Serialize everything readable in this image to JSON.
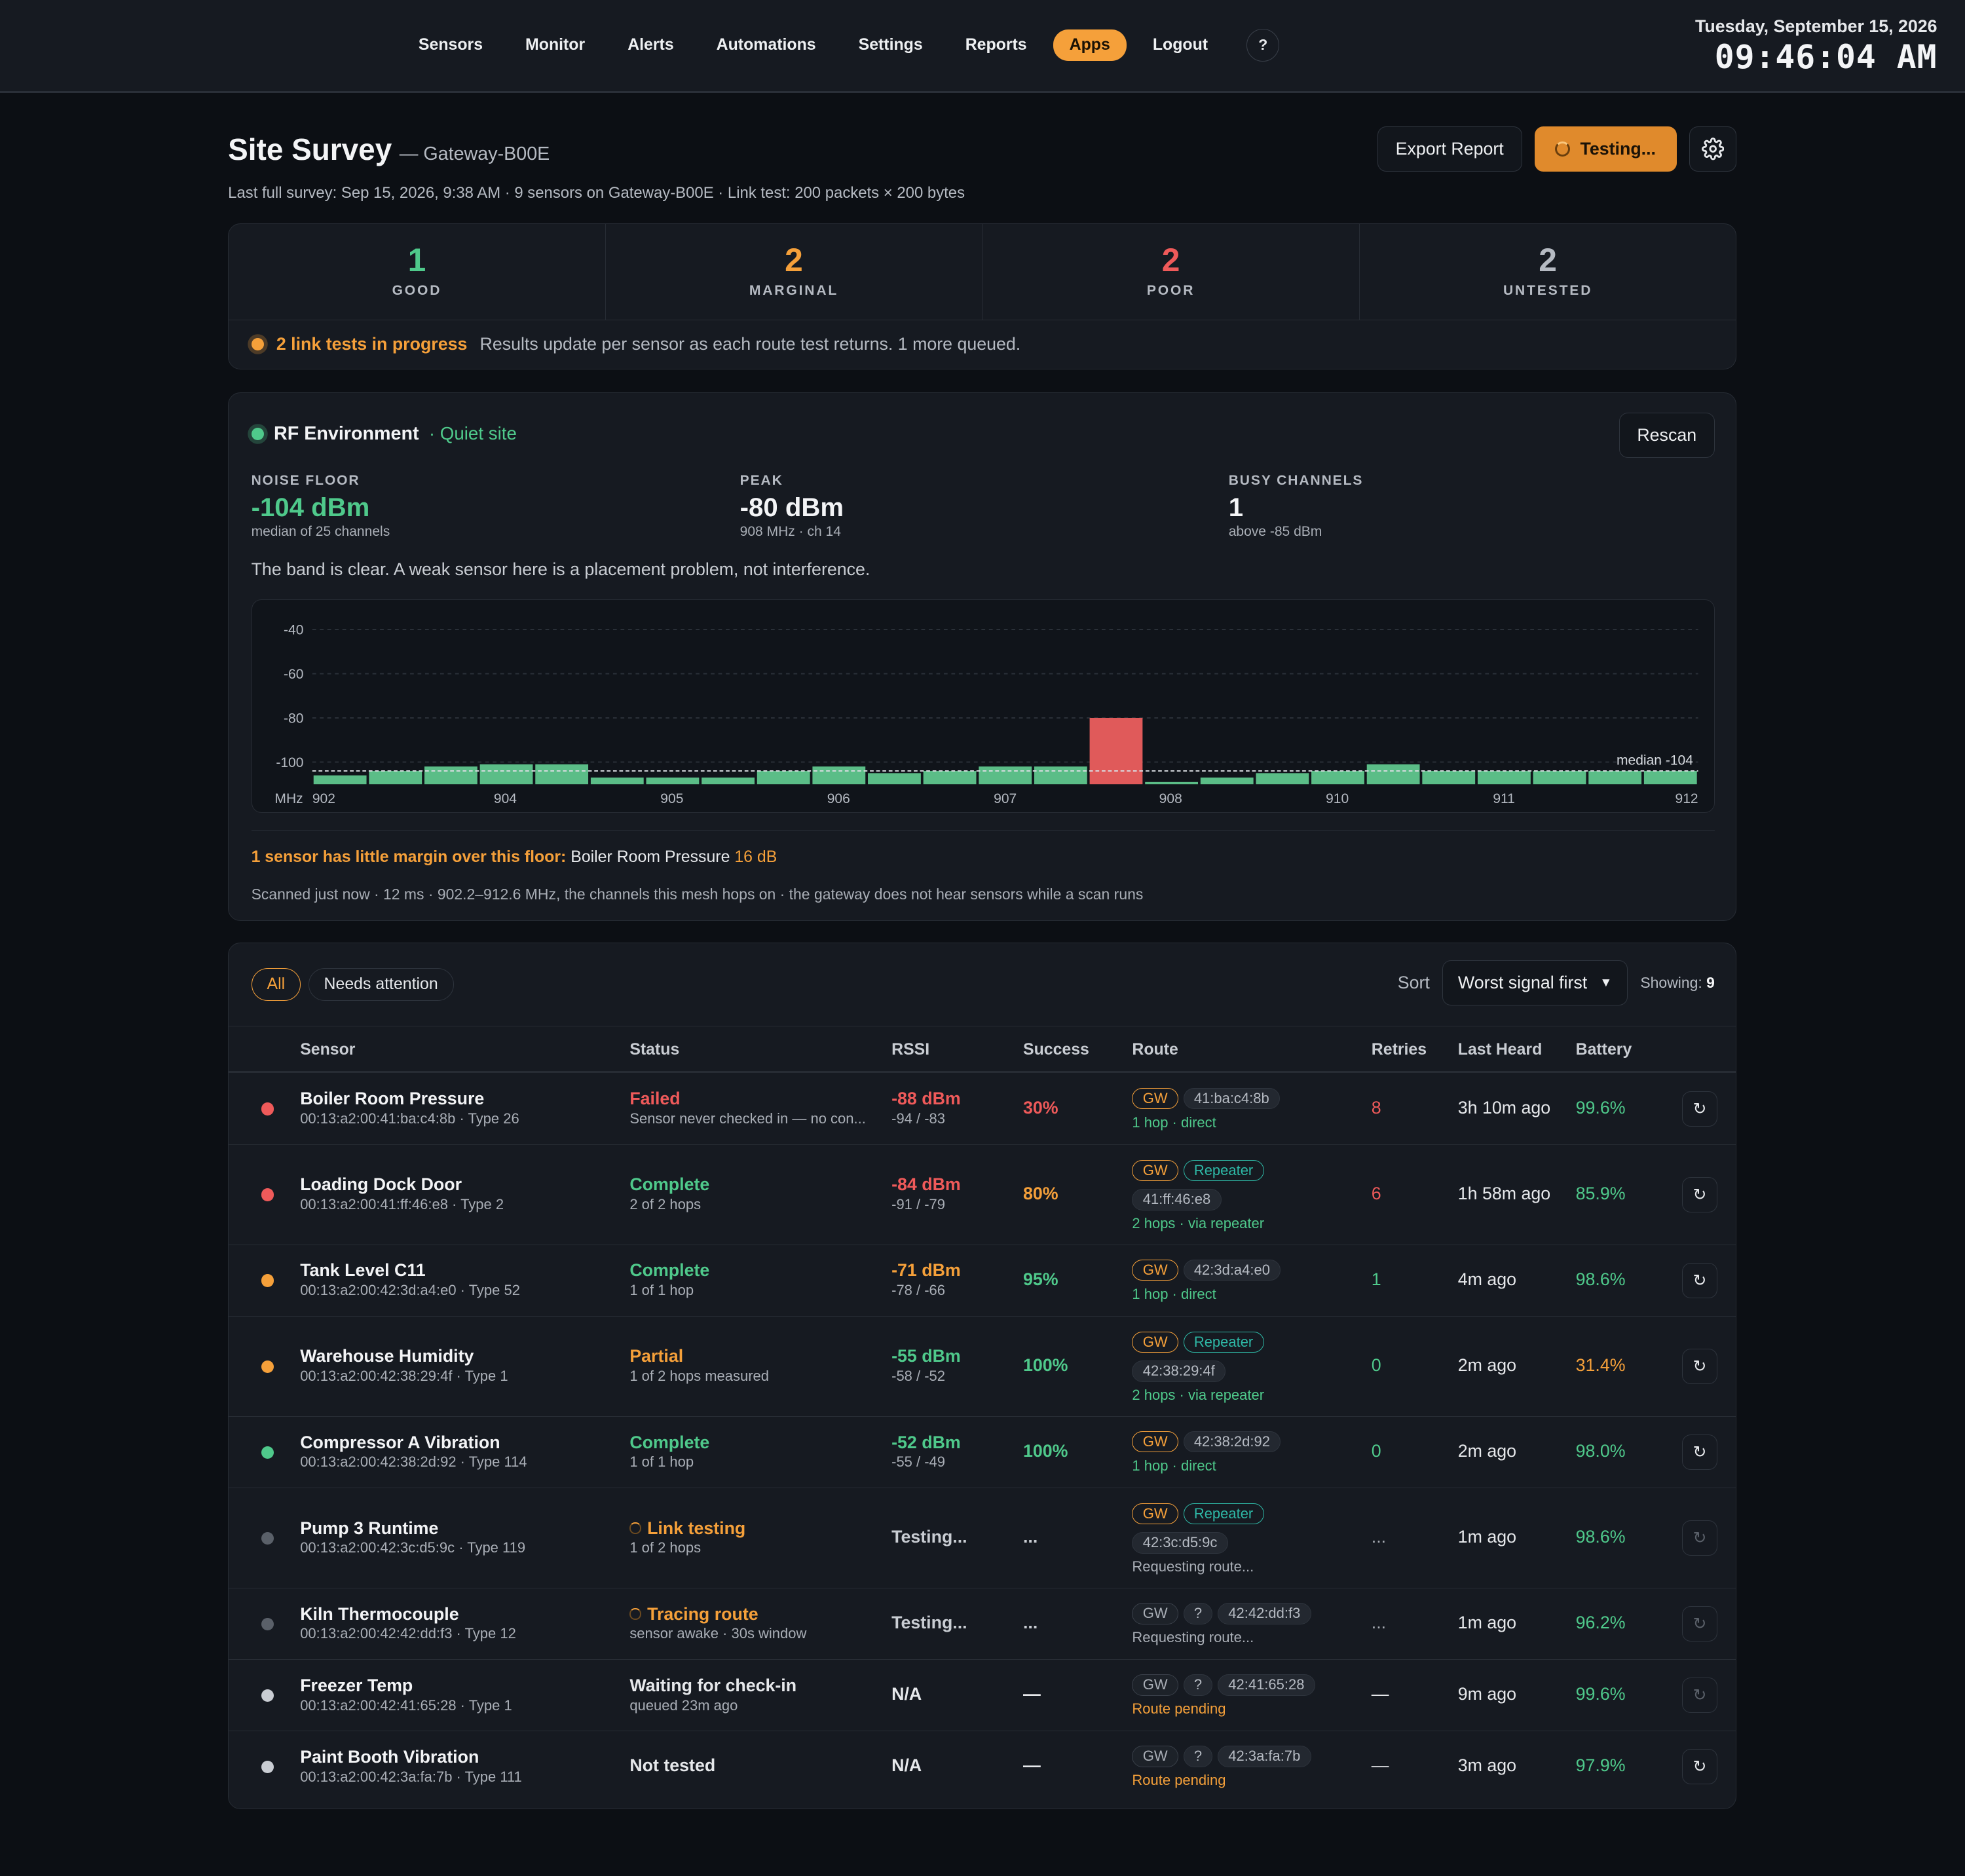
{
  "nav": {
    "items": [
      "Sensors",
      "Monitor",
      "Alerts",
      "Automations",
      "Settings",
      "Reports",
      "Apps",
      "Logout"
    ],
    "active": "Apps",
    "help": "?"
  },
  "clock": {
    "date": "Tuesday, September 15, 2026",
    "time": "09:46:04 AM"
  },
  "header": {
    "title": "Site Survey",
    "gateway": "— Gateway-B00E",
    "subtitle": "Last full survey: Sep 15, 2026, 9:38 AM · 9 sensors on Gateway-B00E · Link test: 200 packets × 200 bytes",
    "export_label": "Export Report",
    "testing_label": "Testing..."
  },
  "counts": [
    {
      "value": "1",
      "label": "GOOD",
      "color": "#4fc98b"
    },
    {
      "value": "2",
      "label": "MARGINAL",
      "color": "#f5a03a"
    },
    {
      "value": "2",
      "label": "POOR",
      "color": "#ef5a5a"
    },
    {
      "value": "2",
      "label": "UNTESTED",
      "color": "#b5bac2"
    }
  ],
  "in_progress": {
    "highlight": "2 link tests in progress",
    "text": "Results update per sensor as each route test returns. 1 more queued."
  },
  "rf": {
    "title": "RF Environment",
    "status": "· Quiet site",
    "rescan_label": "Rescan",
    "metrics": [
      {
        "key": "NOISE FLOOR",
        "value": "-104 dBm",
        "sub": "median of 25 channels",
        "color": "#4fc98b"
      },
      {
        "key": "PEAK",
        "value": "-80 dBm",
        "sub": "908 MHz · ch 14",
        "color": "#f3f4f6"
      },
      {
        "key": "BUSY CHANNELS",
        "value": "1",
        "sub": "above -85 dBm",
        "color": "#f3f4f6"
      }
    ],
    "band_note": "The band is clear. A weak sensor here is a placement problem, not interference.",
    "margin_warn": "1 sensor has little margin over this floor:",
    "margin_sensor": "Boiler Room Pressure",
    "margin_db": "16 dB",
    "scanned": "Scanned just now · 12 ms · 902.2–912.6 MHz, the channels this mesh hops on · the gateway does not hear sensors while a scan runs"
  },
  "chart_data": {
    "type": "bar",
    "title": "",
    "xlabel": "MHz",
    "ylabel": "",
    "ylim": [
      -110,
      -38
    ],
    "yticks": [
      -40,
      -60,
      -80,
      -100
    ],
    "xtick_labels": [
      "902",
      "904",
      "905",
      "906",
      "907",
      "908",
      "910",
      "911",
      "912"
    ],
    "median_label": "median -104",
    "median": -104,
    "values": [
      -106,
      -104,
      -102,
      -101,
      -101,
      -107,
      -107,
      -107,
      -104,
      -102,
      -105,
      -104,
      -102,
      -102,
      -80,
      -109,
      -107,
      -105,
      -104,
      -101,
      -104,
      -104,
      -104,
      -104,
      -104
    ],
    "colors": {
      "normal": "#5bbd87",
      "busy": "#e05a5a"
    },
    "busy_index": 14
  },
  "table": {
    "filters": [
      "All",
      "Needs attention"
    ],
    "sort_label": "Sort",
    "sort_value": "Worst signal first",
    "showing_label": "Showing:",
    "showing_count": "9",
    "columns": [
      "Sensor",
      "Status",
      "RSSI",
      "Success",
      "Route",
      "Retries",
      "Last Heard",
      "Battery"
    ],
    "rows": [
      {
        "dot": "#ef5a5a",
        "name": "Boiler Room Pressure",
        "id": "00:13:a2:00:41:ba:c4:8b · Type 26",
        "status": "Failed",
        "status_color": "#ef5a5a",
        "status_sub": "Sensor never checked in — no con...",
        "rssi": "-88 dBm",
        "rssi_color": "#ef5a5a",
        "rssi_sub": "-94 / -83",
        "success": "30%",
        "success_color": "#ef5a5a",
        "gw": "GW",
        "gw_style": "gw",
        "repeater": "",
        "q": "",
        "mac": "41:ba:c4:8b",
        "route_line": "1 hop · direct",
        "route_color": "#4fc98b",
        "retries": "8",
        "retries_color": "#ef5a5a",
        "last": "3h 10m ago",
        "battery": "99.6%",
        "battery_color": "#4fc98b",
        "btn_dim": false,
        "spin": false
      },
      {
        "dot": "#ef5a5a",
        "name": "Loading Dock Door",
        "id": "00:13:a2:00:41:ff:46:e8 · Type 2",
        "status": "Complete",
        "status_color": "#4fc98b",
        "status_sub": "2 of 2 hops",
        "rssi": "-84 dBm",
        "rssi_color": "#ef5a5a",
        "rssi_sub": "-91 / -79",
        "success": "80%",
        "success_color": "#f5a03a",
        "gw": "GW",
        "gw_style": "gw",
        "repeater": "Repeater",
        "q": "",
        "mac": "41:ff:46:e8",
        "route_line": "2 hops · via repeater",
        "route_color": "#4fc98b",
        "retries": "6",
        "retries_color": "#ef5a5a",
        "last": "1h 58m ago",
        "battery": "85.9%",
        "battery_color": "#4fc98b",
        "btn_dim": false,
        "spin": false
      },
      {
        "dot": "#f5a03a",
        "name": "Tank Level C11",
        "id": "00:13:a2:00:42:3d:a4:e0 · Type 52",
        "status": "Complete",
        "status_color": "#4fc98b",
        "status_sub": "1 of 1 hop",
        "rssi": "-71 dBm",
        "rssi_color": "#f5a03a",
        "rssi_sub": "-78 / -66",
        "success": "95%",
        "success_color": "#4fc98b",
        "gw": "GW",
        "gw_style": "gw",
        "repeater": "",
        "q": "",
        "mac": "42:3d:a4:e0",
        "route_line": "1 hop · direct",
        "route_color": "#4fc98b",
        "retries": "1",
        "retries_color": "#4fc98b",
        "last": "4m ago",
        "battery": "98.6%",
        "battery_color": "#4fc98b",
        "btn_dim": false,
        "spin": false
      },
      {
        "dot": "#f5a03a",
        "name": "Warehouse Humidity",
        "id": "00:13:a2:00:42:38:29:4f · Type 1",
        "status": "Partial",
        "status_color": "#f5a03a",
        "status_sub": "1 of 2 hops measured",
        "rssi": "-55 dBm",
        "rssi_color": "#4fc98b",
        "rssi_sub": "-58 / -52",
        "success": "100%",
        "success_color": "#4fc98b",
        "gw": "GW",
        "gw_style": "gw",
        "repeater": "Repeater",
        "q": "",
        "mac": "42:38:29:4f",
        "route_line": "2 hops · via repeater",
        "route_color": "#4fc98b",
        "retries": "0",
        "retries_color": "#4fc98b",
        "last": "2m ago",
        "battery": "31.4%",
        "battery_color": "#f5a03a",
        "btn_dim": false,
        "spin": false
      },
      {
        "dot": "#4fc98b",
        "name": "Compressor A Vibration",
        "id": "00:13:a2:00:42:38:2d:92 · Type 114",
        "status": "Complete",
        "status_color": "#4fc98b",
        "status_sub": "1 of 1 hop",
        "rssi": "-52 dBm",
        "rssi_color": "#4fc98b",
        "rssi_sub": "-55 / -49",
        "success": "100%",
        "success_color": "#4fc98b",
        "gw": "GW",
        "gw_style": "gw",
        "repeater": "",
        "q": "",
        "mac": "42:38:2d:92",
        "route_line": "1 hop · direct",
        "route_color": "#4fc98b",
        "retries": "0",
        "retries_color": "#4fc98b",
        "last": "2m ago",
        "battery": "98.0%",
        "battery_color": "#4fc98b",
        "btn_dim": false,
        "spin": false
      },
      {
        "dot": "#5a6069",
        "name": "Pump 3 Runtime",
        "id": "00:13:a2:00:42:3c:d5:9c · Type 119",
        "status": "Link testing",
        "status_color": "#f5a03a",
        "status_sub": "1 of 2 hops",
        "rssi": "Testing...",
        "rssi_color": "#c9cdd3",
        "rssi_sub": "",
        "success": "...",
        "success_color": "#c9cdd3",
        "gw": "GW",
        "gw_style": "gw",
        "repeater": "Repeater",
        "q": "",
        "mac": "42:3c:d5:9c",
        "route_line": "Requesting route...",
        "route_color": "#a9aeb6",
        "retries": "...",
        "retries_color": "#a9aeb6",
        "last": "1m ago",
        "battery": "98.6%",
        "battery_color": "#4fc98b",
        "btn_dim": true,
        "spin": true
      },
      {
        "dot": "#5a6069",
        "name": "Kiln Thermocouple",
        "id": "00:13:a2:00:42:42:dd:f3 · Type 12",
        "status": "Tracing route",
        "status_color": "#f5a03a",
        "status_sub": "sensor awake · 30s window",
        "rssi": "Testing...",
        "rssi_color": "#c9cdd3",
        "rssi_sub": "",
        "success": "...",
        "success_color": "#c9cdd3",
        "gw": "GW",
        "gw_style": "gwg",
        "repeater": "",
        "q": "?",
        "mac": "42:42:dd:f3",
        "route_line": "Requesting route...",
        "route_color": "#a9aeb6",
        "retries": "...",
        "retries_color": "#a9aeb6",
        "last": "1m ago",
        "battery": "96.2%",
        "battery_color": "#4fc98b",
        "btn_dim": true,
        "spin": true
      },
      {
        "dot": "#c9cdd3",
        "name": "Freezer Temp",
        "id": "00:13:a2:00:42:41:65:28 · Type 1",
        "status": "Waiting for check-in",
        "status_color": "#e6e8eb",
        "status_sub": "queued 23m ago",
        "rssi": "N/A",
        "rssi_color": "#e6e8eb",
        "rssi_sub": "",
        "success": "—",
        "success_color": "#e6e8eb",
        "gw": "GW",
        "gw_style": "gwg",
        "repeater": "",
        "q": "?",
        "mac": "42:41:65:28",
        "route_line": "Route pending",
        "route_color": "#f5a03a",
        "retries": "—",
        "retries_color": "#e6e8eb",
        "last": "9m ago",
        "battery": "99.6%",
        "battery_color": "#4fc98b",
        "btn_dim": true,
        "spin": false
      },
      {
        "dot": "#c9cdd3",
        "name": "Paint Booth Vibration",
        "id": "00:13:a2:00:42:3a:fa:7b · Type 111",
        "status": "Not tested",
        "status_color": "#e6e8eb",
        "status_sub": "",
        "rssi": "N/A",
        "rssi_color": "#e6e8eb",
        "rssi_sub": "",
        "success": "—",
        "success_color": "#e6e8eb",
        "gw": "GW",
        "gw_style": "gwg",
        "repeater": "",
        "q": "?",
        "mac": "42:3a:fa:7b",
        "route_line": "Route pending",
        "route_color": "#f5a03a",
        "retries": "—",
        "retries_color": "#e6e8eb",
        "last": "3m ago",
        "battery": "97.9%",
        "battery_color": "#4fc98b",
        "btn_dim": false,
        "spin": false
      }
    ]
  }
}
